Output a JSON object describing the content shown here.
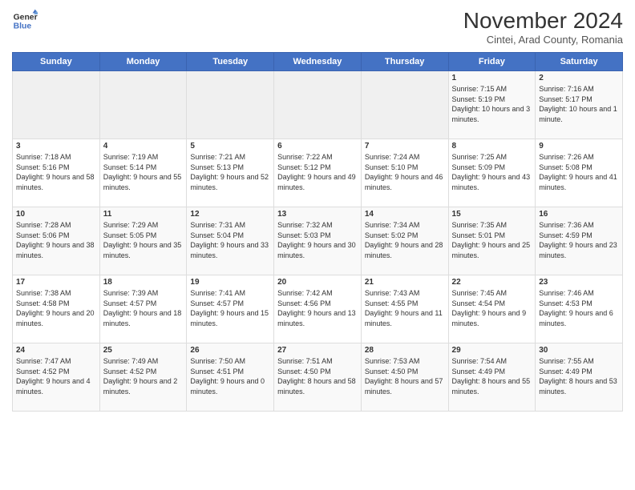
{
  "logo": {
    "line1": "General",
    "line2": "Blue"
  },
  "title": "November 2024",
  "subtitle": "Cintei, Arad County, Romania",
  "weekdays": [
    "Sunday",
    "Monday",
    "Tuesday",
    "Wednesday",
    "Thursday",
    "Friday",
    "Saturday"
  ],
  "weeks": [
    [
      {
        "day": "",
        "empty": true
      },
      {
        "day": "",
        "empty": true
      },
      {
        "day": "",
        "empty": true
      },
      {
        "day": "",
        "empty": true
      },
      {
        "day": "",
        "empty": true
      },
      {
        "day": "1",
        "sunrise": "7:15 AM",
        "sunset": "5:19 PM",
        "daylight": "10 hours and 3 minutes."
      },
      {
        "day": "2",
        "sunrise": "7:16 AM",
        "sunset": "5:17 PM",
        "daylight": "10 hours and 1 minute."
      }
    ],
    [
      {
        "day": "3",
        "sunrise": "7:18 AM",
        "sunset": "5:16 PM",
        "daylight": "9 hours and 58 minutes."
      },
      {
        "day": "4",
        "sunrise": "7:19 AM",
        "sunset": "5:14 PM",
        "daylight": "9 hours and 55 minutes."
      },
      {
        "day": "5",
        "sunrise": "7:21 AM",
        "sunset": "5:13 PM",
        "daylight": "9 hours and 52 minutes."
      },
      {
        "day": "6",
        "sunrise": "7:22 AM",
        "sunset": "5:12 PM",
        "daylight": "9 hours and 49 minutes."
      },
      {
        "day": "7",
        "sunrise": "7:24 AM",
        "sunset": "5:10 PM",
        "daylight": "9 hours and 46 minutes."
      },
      {
        "day": "8",
        "sunrise": "7:25 AM",
        "sunset": "5:09 PM",
        "daylight": "9 hours and 43 minutes."
      },
      {
        "day": "9",
        "sunrise": "7:26 AM",
        "sunset": "5:08 PM",
        "daylight": "9 hours and 41 minutes."
      }
    ],
    [
      {
        "day": "10",
        "sunrise": "7:28 AM",
        "sunset": "5:06 PM",
        "daylight": "9 hours and 38 minutes."
      },
      {
        "day": "11",
        "sunrise": "7:29 AM",
        "sunset": "5:05 PM",
        "daylight": "9 hours and 35 minutes."
      },
      {
        "day": "12",
        "sunrise": "7:31 AM",
        "sunset": "5:04 PM",
        "daylight": "9 hours and 33 minutes."
      },
      {
        "day": "13",
        "sunrise": "7:32 AM",
        "sunset": "5:03 PM",
        "daylight": "9 hours and 30 minutes."
      },
      {
        "day": "14",
        "sunrise": "7:34 AM",
        "sunset": "5:02 PM",
        "daylight": "9 hours and 28 minutes."
      },
      {
        "day": "15",
        "sunrise": "7:35 AM",
        "sunset": "5:01 PM",
        "daylight": "9 hours and 25 minutes."
      },
      {
        "day": "16",
        "sunrise": "7:36 AM",
        "sunset": "4:59 PM",
        "daylight": "9 hours and 23 minutes."
      }
    ],
    [
      {
        "day": "17",
        "sunrise": "7:38 AM",
        "sunset": "4:58 PM",
        "daylight": "9 hours and 20 minutes."
      },
      {
        "day": "18",
        "sunrise": "7:39 AM",
        "sunset": "4:57 PM",
        "daylight": "9 hours and 18 minutes."
      },
      {
        "day": "19",
        "sunrise": "7:41 AM",
        "sunset": "4:57 PM",
        "daylight": "9 hours and 15 minutes."
      },
      {
        "day": "20",
        "sunrise": "7:42 AM",
        "sunset": "4:56 PM",
        "daylight": "9 hours and 13 minutes."
      },
      {
        "day": "21",
        "sunrise": "7:43 AM",
        "sunset": "4:55 PM",
        "daylight": "9 hours and 11 minutes."
      },
      {
        "day": "22",
        "sunrise": "7:45 AM",
        "sunset": "4:54 PM",
        "daylight": "9 hours and 9 minutes."
      },
      {
        "day": "23",
        "sunrise": "7:46 AM",
        "sunset": "4:53 PM",
        "daylight": "9 hours and 6 minutes."
      }
    ],
    [
      {
        "day": "24",
        "sunrise": "7:47 AM",
        "sunset": "4:52 PM",
        "daylight": "9 hours and 4 minutes."
      },
      {
        "day": "25",
        "sunrise": "7:49 AM",
        "sunset": "4:52 PM",
        "daylight": "9 hours and 2 minutes."
      },
      {
        "day": "26",
        "sunrise": "7:50 AM",
        "sunset": "4:51 PM",
        "daylight": "9 hours and 0 minutes."
      },
      {
        "day": "27",
        "sunrise": "7:51 AM",
        "sunset": "4:50 PM",
        "daylight": "8 hours and 58 minutes."
      },
      {
        "day": "28",
        "sunrise": "7:53 AM",
        "sunset": "4:50 PM",
        "daylight": "8 hours and 57 minutes."
      },
      {
        "day": "29",
        "sunrise": "7:54 AM",
        "sunset": "4:49 PM",
        "daylight": "8 hours and 55 minutes."
      },
      {
        "day": "30",
        "sunrise": "7:55 AM",
        "sunset": "4:49 PM",
        "daylight": "8 hours and 53 minutes."
      }
    ]
  ],
  "labels": {
    "sunrise": "Sunrise:",
    "sunset": "Sunset:",
    "daylight": "Daylight:"
  }
}
